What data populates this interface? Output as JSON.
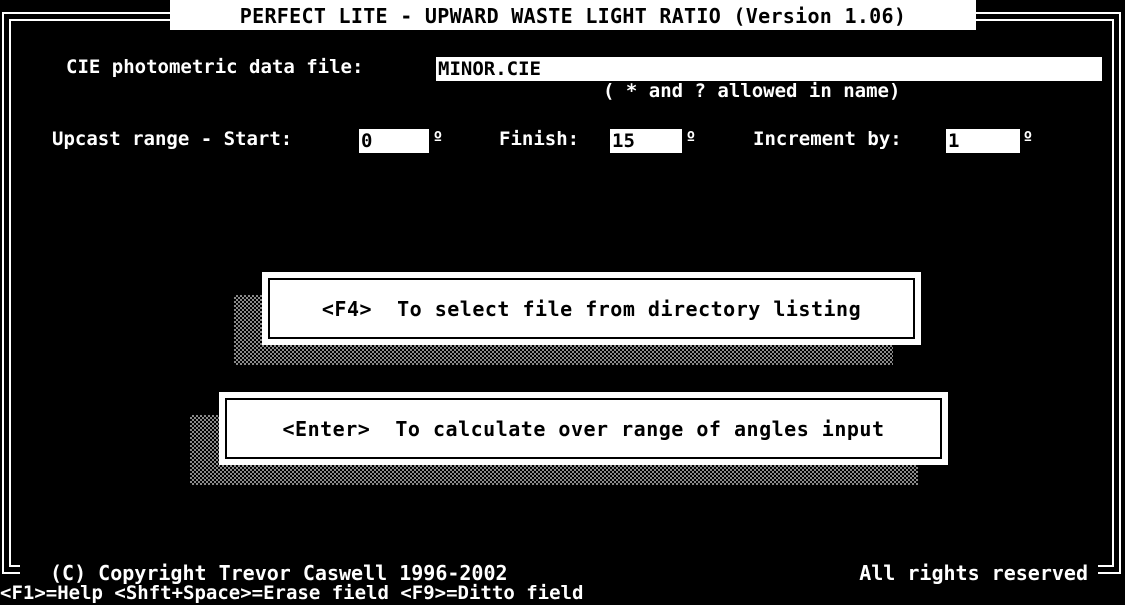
{
  "window": {
    "title": "PERFECT LITE - UPWARD WASTE LIGHT RATIO (Version 1.06)"
  },
  "form": {
    "file_label": "CIE photometric data file:",
    "file_value": "MINOR.CIE",
    "wildcard_hint": "( * and ? allowed in name)",
    "range_label": "Upcast range - Start:",
    "start_value": "0",
    "finish_label": "Finish:",
    "finish_value": "15",
    "increment_label": "Increment by:",
    "increment_value": "1",
    "degree_symbol": "º"
  },
  "menu": {
    "select_file": "<F4>  To select file from directory listing",
    "calculate": "<Enter>  To calculate over range of angles input"
  },
  "footer": {
    "copyright": "(C) Copyright  Trevor Caswell  1996-2002",
    "rights": "All rights reserved",
    "help_keys": "<F1>=Help <Shft+Space>=Erase field <F9>=Ditto field"
  }
}
